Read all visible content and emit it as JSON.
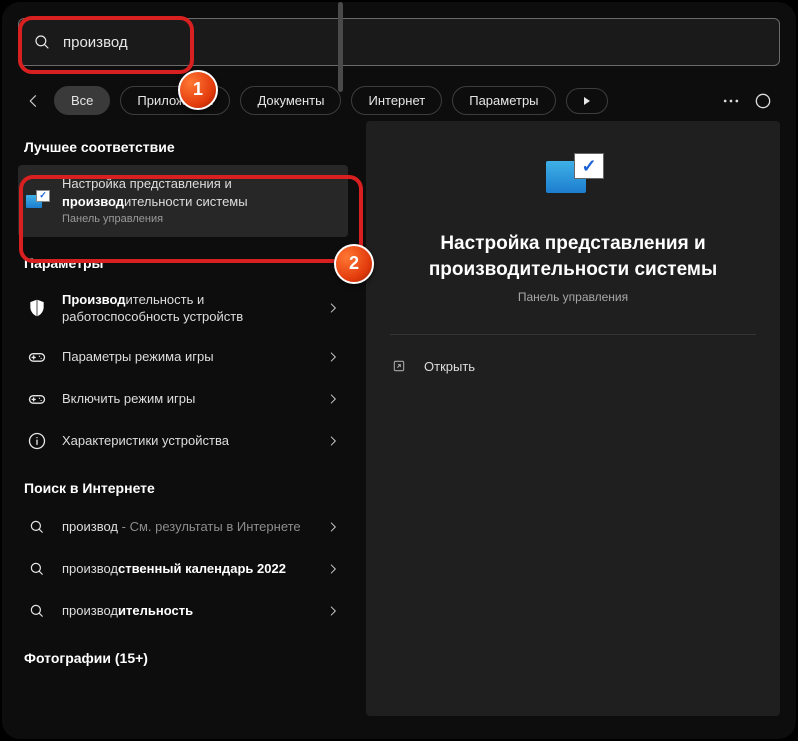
{
  "search": {
    "value": "производ"
  },
  "tabs": {
    "all": "Все",
    "apps": "Приложения",
    "docs": "Документы",
    "internet": "Интернет",
    "params": "Параметры"
  },
  "sections": {
    "best": "Лучшее соответствие",
    "params": "Параметры",
    "web": "Поиск в Интернете",
    "photos": "Фотографии (15+)"
  },
  "results": {
    "best": {
      "line1": "Настройка представления и",
      "line2_bold": "производ",
      "line2_rest": "ительности системы",
      "sub": "Панель управления"
    },
    "params": [
      {
        "bold": "Производ",
        "rest": "ительность и работоспособность устройств",
        "icon": "shield"
      },
      {
        "plain": "Параметры режима игры",
        "icon": "gamepad"
      },
      {
        "plain": "Включить режим игры",
        "icon": "gamepad"
      },
      {
        "plain": "Характеристики устройства",
        "icon": "info"
      }
    ],
    "web": [
      {
        "bold_pre": "производ",
        "gray": " - См. результаты в Интернете"
      },
      {
        "pre": "производ",
        "bold_rest": "ственный календарь 2022"
      },
      {
        "pre": "производ",
        "bold_rest": "ительность"
      }
    ]
  },
  "preview": {
    "title_l1": "Настройка представления и",
    "title_l2": "производительности системы",
    "sub": "Панель управления",
    "open": "Открыть"
  },
  "annotations": {
    "b1": "1",
    "b2": "2"
  }
}
